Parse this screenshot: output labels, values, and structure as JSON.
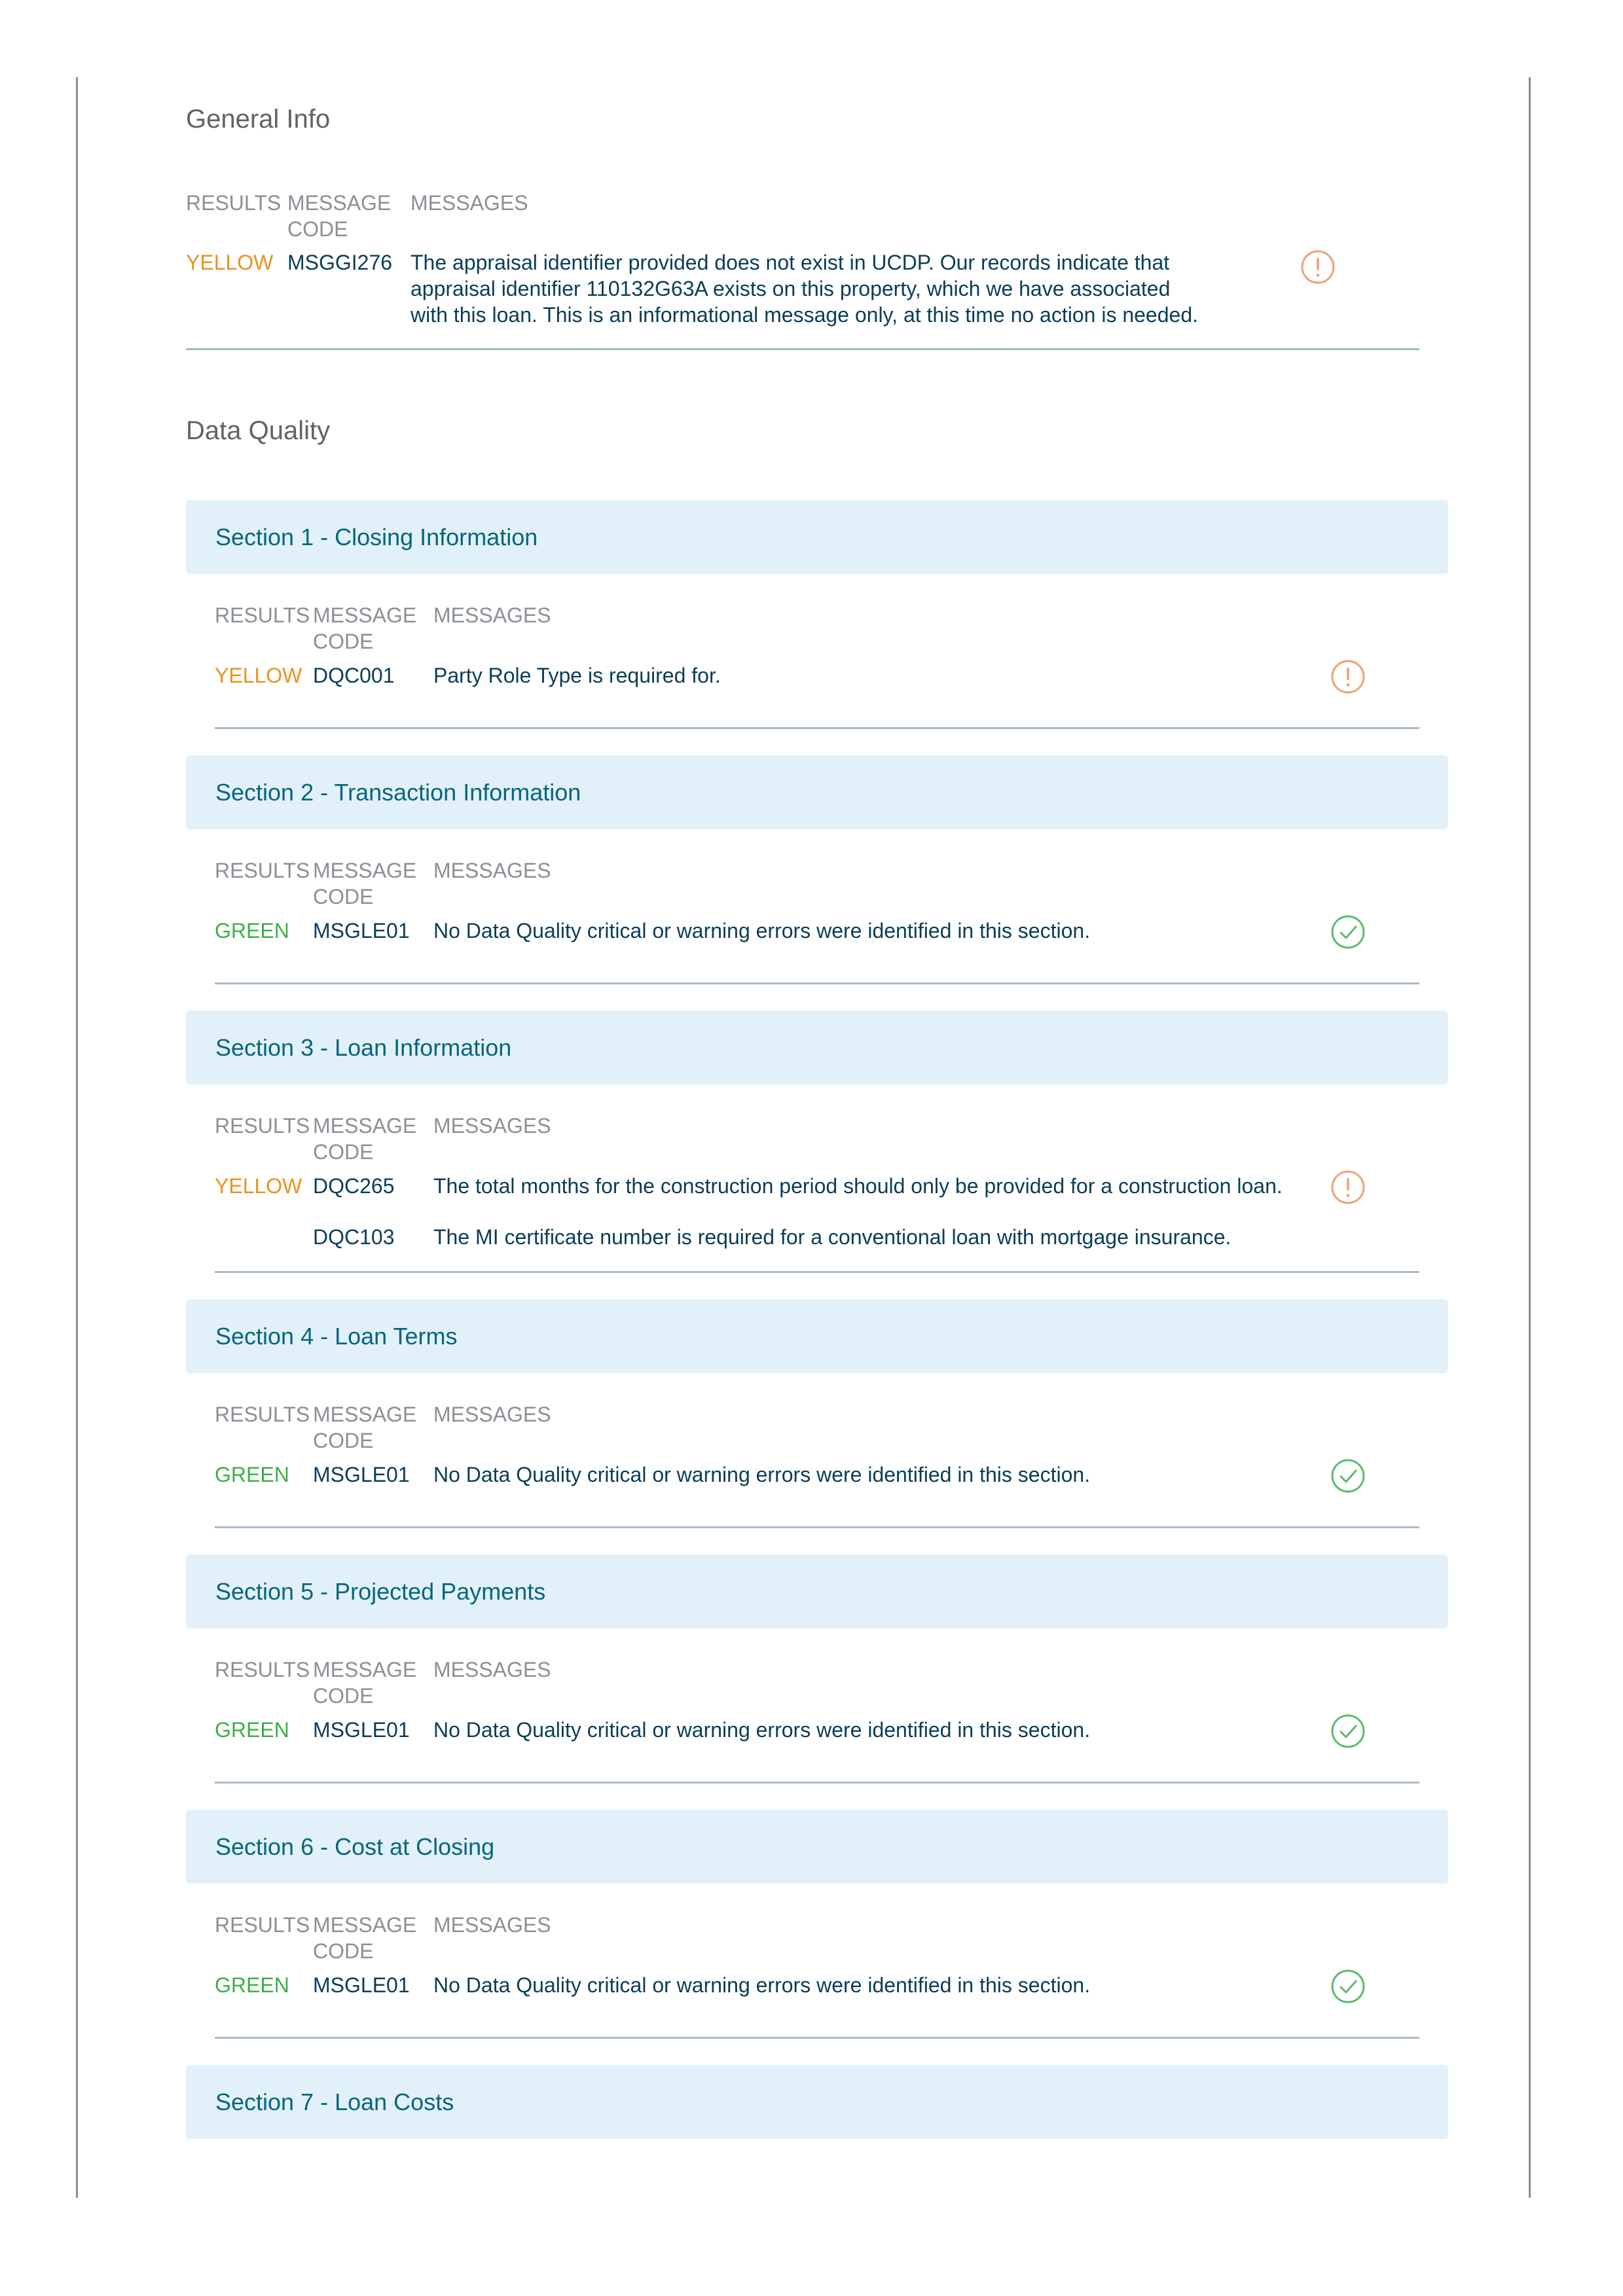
{
  "colors": {
    "yellow": "#e9931f",
    "green": "#3fae49",
    "warning_icon": "#f0a07a",
    "check_icon": "#5cba6b",
    "section_bg": "#e2f1f9",
    "section_title": "#07657f"
  },
  "general_info": {
    "title": "General Info",
    "headers": {
      "results": "RESULTS",
      "message_code_1": "MESSAGE",
      "message_code_2": "CODE",
      "messages": "MESSAGES"
    },
    "rows": [
      {
        "result": "YELLOW",
        "code": "MSGGI276",
        "message_lines": [
          "The appraisal identifier provided does not exist in UCDP. Our records indicate that",
          "appraisal identifier 110132G63A exists on this property, which we have associated",
          "with this loan. This is an informational message only, at this time no action is needed."
        ],
        "icon": "warning-icon"
      }
    ]
  },
  "data_quality": {
    "title": "Data Quality",
    "headers": {
      "results": "RESULTS",
      "message_code_1": "MESSAGE",
      "message_code_2": "CODE",
      "messages": "MESSAGES"
    },
    "sections": [
      {
        "title": "Section 1 - Closing Information",
        "rows": [
          {
            "result": "YELLOW",
            "code": "DQC001",
            "message": "Party Role Type is required for.",
            "icon": "warning-icon"
          }
        ]
      },
      {
        "title": "Section 2 - Transaction Information",
        "rows": [
          {
            "result": "GREEN",
            "code": "MSGLE01",
            "message": "No Data Quality critical or warning errors were identified in this section.",
            "icon": "check-circle-icon"
          }
        ]
      },
      {
        "title": "Section 3 - Loan Information",
        "rows": [
          {
            "result": "YELLOW",
            "code": "DQC265",
            "message": "The total months for the construction period should only be provided for a construction loan.",
            "icon": "warning-icon"
          },
          {
            "result": "",
            "code": "DQC103",
            "message": "The MI certificate number is required for a conventional loan with mortgage insurance.",
            "icon": ""
          }
        ]
      },
      {
        "title": "Section 4 - Loan Terms",
        "rows": [
          {
            "result": "GREEN",
            "code": "MSGLE01",
            "message": "No Data Quality critical or warning errors were identified in this section.",
            "icon": "check-circle-icon"
          }
        ]
      },
      {
        "title": "Section 5 - Projected Payments",
        "rows": [
          {
            "result": "GREEN",
            "code": "MSGLE01",
            "message": "No Data Quality critical or warning errors were identified in this section.",
            "icon": "check-circle-icon"
          }
        ]
      },
      {
        "title": "Section 6 - Cost at Closing",
        "rows": [
          {
            "result": "GREEN",
            "code": "MSGLE01",
            "message": "No Data Quality critical or warning errors were identified in this section.",
            "icon": "check-circle-icon"
          }
        ]
      },
      {
        "title": "Section 7 - Loan Costs",
        "rows": []
      }
    ]
  }
}
